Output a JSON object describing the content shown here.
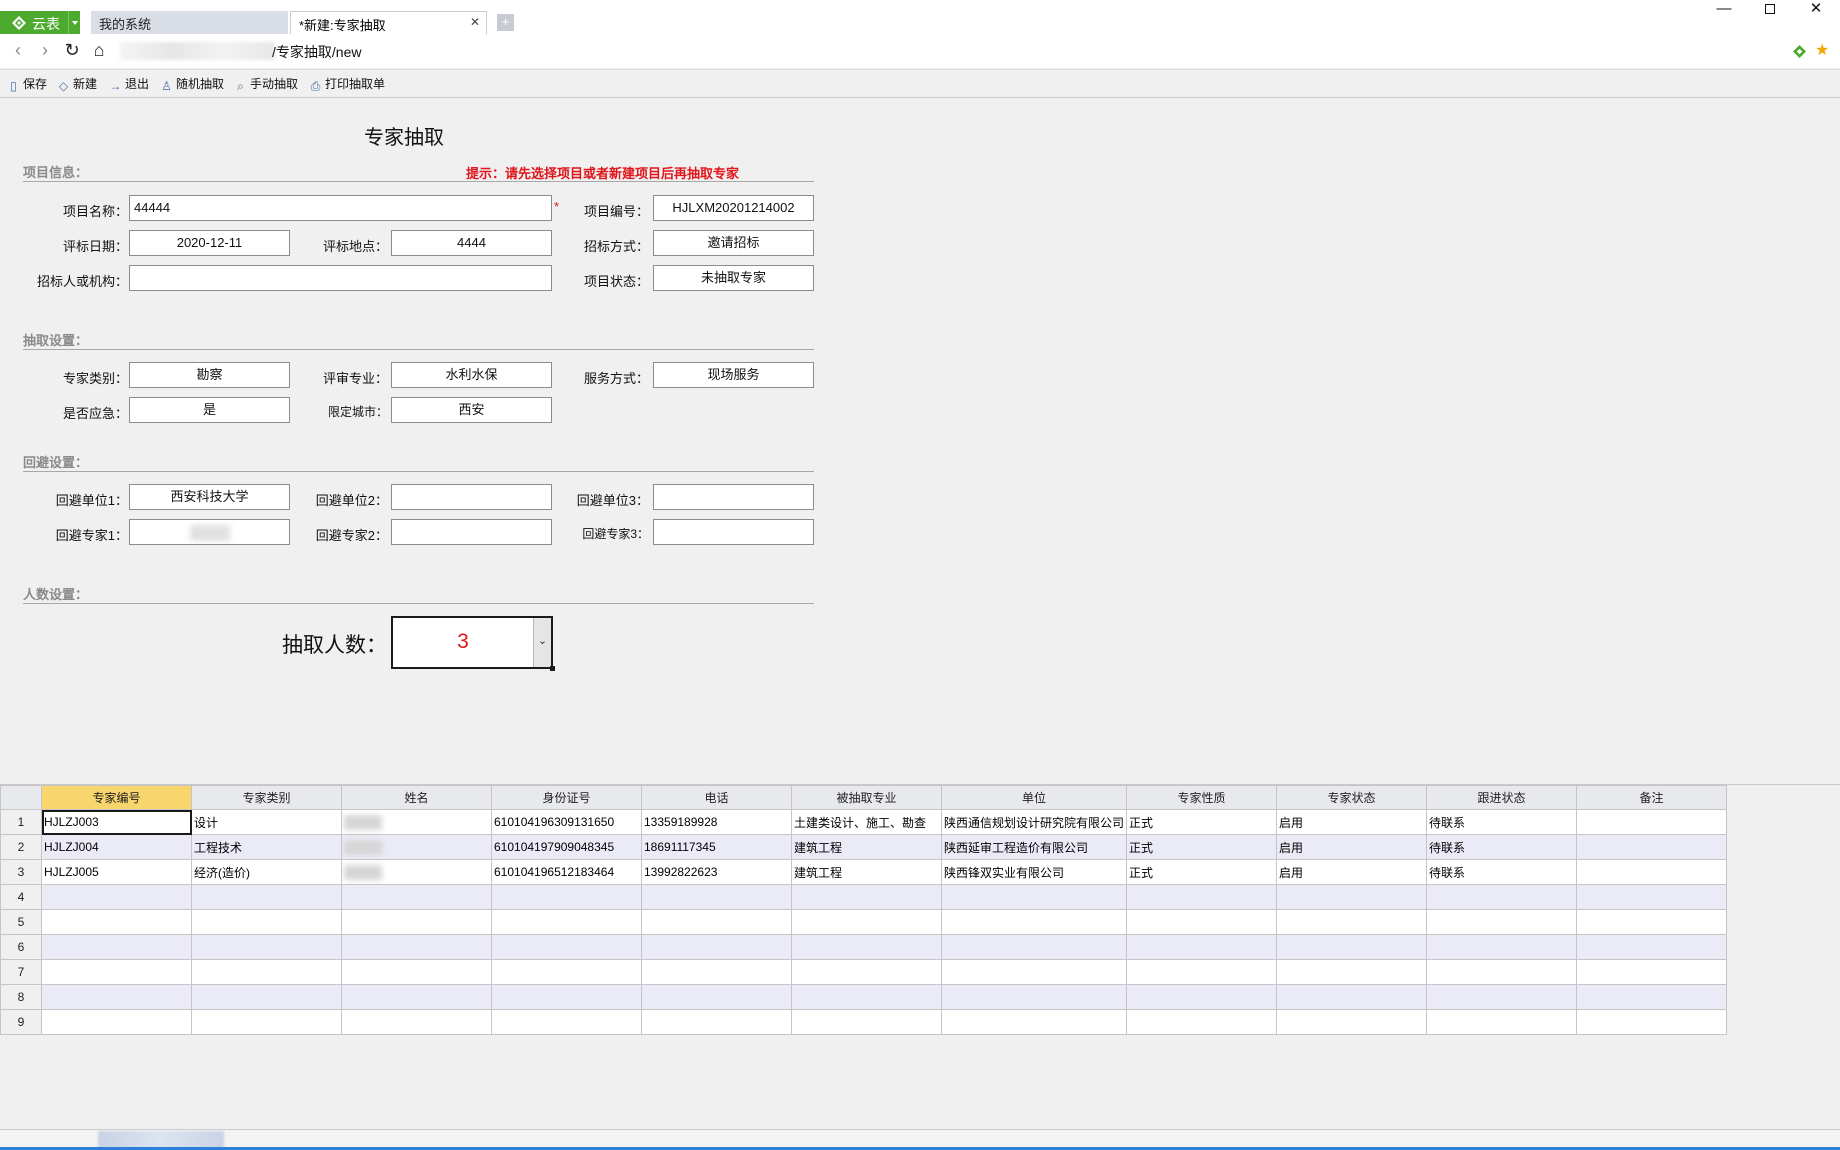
{
  "app": {
    "name": "云表"
  },
  "tabs": [
    {
      "label": "我的系统"
    },
    {
      "label": "*新建:专家抽取",
      "close": "✕"
    }
  ],
  "url": {
    "path": "/专家抽取/new"
  },
  "toolbar": {
    "save": "保存",
    "new": "新建",
    "exit": "退出",
    "random": "随机抽取",
    "manual": "手动抽取",
    "print": "打印抽取单"
  },
  "form": {
    "title": "专家抽取",
    "hint": "提示：请先选择项目或者新建项目后再抽取专家",
    "sections": {
      "project": "项目信息：",
      "draw": "抽取设置：",
      "avoid": "回避设置：",
      "count": "人数设置："
    },
    "project": {
      "name_label": "项目名称：",
      "name": "44444",
      "code_label": "项目编号：",
      "code": "HJLXM20201214002",
      "date_label": "评标日期：",
      "date": "2020-12-11",
      "place_label": "评标地点：",
      "place": "4444",
      "method_label": "招标方式：",
      "method": "邀请招标",
      "org_label": "招标人或机构：",
      "org": "",
      "status_label": "项目状态：",
      "status": "未抽取专家"
    },
    "draw": {
      "category_label": "专家类别：",
      "category": "勘察",
      "major_label": "评审专业：",
      "major": "水利水保",
      "service_label": "服务方式：",
      "service": "现场服务",
      "urgent_label": "是否应急：",
      "urgent": "是",
      "city_label": "限定城市：",
      "city": "西安"
    },
    "avoid": {
      "unit1_label": "回避单位1：",
      "unit1": "西安科技大学",
      "unit2_label": "回避单位2：",
      "unit2": "",
      "unit3_label": "回避单位3：",
      "unit3": "",
      "expert1_label": "回避专家1：",
      "expert2_label": "回避专家2：",
      "expert2": "",
      "expert3_label": "回避专家3：",
      "expert3": ""
    },
    "count": {
      "label": "抽取人数：",
      "value": "3"
    }
  },
  "grid": {
    "columns": [
      "专家编号",
      "专家类别",
      "姓名",
      "身份证号",
      "电话",
      "被抽取专业",
      "单位",
      "专家性质",
      "专家状态",
      "跟进状态",
      "备注"
    ],
    "rows": [
      {
        "n": "1",
        "cells": [
          "HJLZJ003",
          "设计",
          "",
          "610104196309131650",
          "13359189928",
          "土建类设计、施工、勘查",
          "陕西通信规划设计研究院有限公司",
          "正式",
          "启用",
          "待联系",
          ""
        ]
      },
      {
        "n": "2",
        "cells": [
          "HJLZJ004",
          "工程技术",
          "",
          "610104197909048345",
          "18691117345",
          "建筑工程",
          "陕西延审工程造价有限公司",
          "正式",
          "启用",
          "待联系",
          ""
        ]
      },
      {
        "n": "3",
        "cells": [
          "HJLZJ005",
          "经济(造价)",
          "",
          "610104196512183464",
          "13992822623",
          "建筑工程",
          "陕西锋双实业有限公司",
          "正式",
          "启用",
          "待联系",
          ""
        ]
      },
      {
        "n": "4",
        "cells": [
          "",
          "",
          "",
          "",
          "",
          "",
          "",
          "",
          "",
          "",
          ""
        ]
      },
      {
        "n": "5",
        "cells": [
          "",
          "",
          "",
          "",
          "",
          "",
          "",
          "",
          "",
          "",
          ""
        ]
      },
      {
        "n": "6",
        "cells": [
          "",
          "",
          "",
          "",
          "",
          "",
          "",
          "",
          "",
          "",
          ""
        ]
      },
      {
        "n": "7",
        "cells": [
          "",
          "",
          "",
          "",
          "",
          "",
          "",
          "",
          "",
          "",
          ""
        ]
      },
      {
        "n": "8",
        "cells": [
          "",
          "",
          "",
          "",
          "",
          "",
          "",
          "",
          "",
          "",
          ""
        ]
      },
      {
        "n": "9",
        "cells": [
          "",
          "",
          "",
          "",
          "",
          "",
          "",
          "",
          "",
          "",
          ""
        ]
      }
    ]
  },
  "colors": {
    "accent": "#4caa2e",
    "required": "#e0141a",
    "selected_header": "#f9d56d",
    "row_alt": "#ebebf7"
  }
}
